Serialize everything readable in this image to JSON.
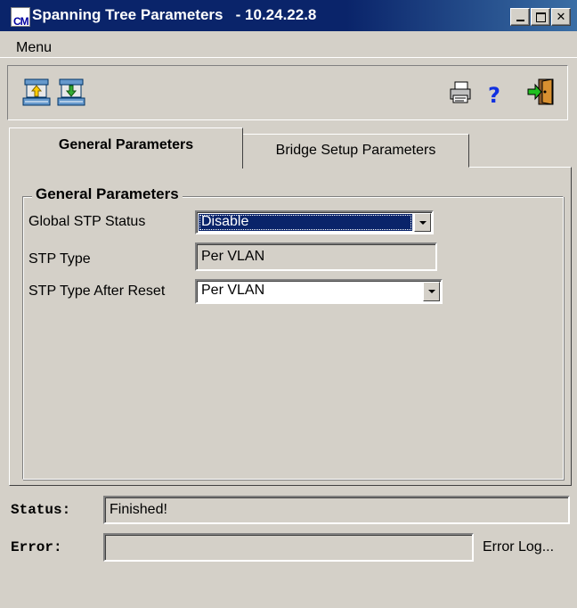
{
  "window": {
    "title": "Spanning Tree Parameters   - 10.24.22.8",
    "logo_text_top": "",
    "logo_text_bottom": "CM"
  },
  "menu": {
    "label": "Menu"
  },
  "toolbar": {
    "upload_icon": "upload-icon",
    "download_icon": "download-icon",
    "print_icon": "printer-icon",
    "help_icon": "help-icon",
    "exit_icon": "exit-icon"
  },
  "tabs": [
    {
      "label": "General Parameters",
      "selected": true
    },
    {
      "label": "Bridge Setup Parameters",
      "selected": false
    }
  ],
  "general": {
    "group_title": "General Parameters",
    "global_stp_status": {
      "label": "Global STP Status",
      "value": "Disable"
    },
    "stp_type": {
      "label": "STP Type",
      "value": "Per VLAN"
    },
    "stp_type_after_reset": {
      "label": "STP Type After Reset",
      "value": "Per VLAN"
    }
  },
  "status": {
    "label": "Status:",
    "value": "Finished!"
  },
  "error": {
    "label": "Error:",
    "value": "",
    "log_link": "Error Log..."
  },
  "colors": {
    "titlebar": "#0a246a",
    "selection": "#0a246a",
    "face": "#d4d0c8"
  }
}
